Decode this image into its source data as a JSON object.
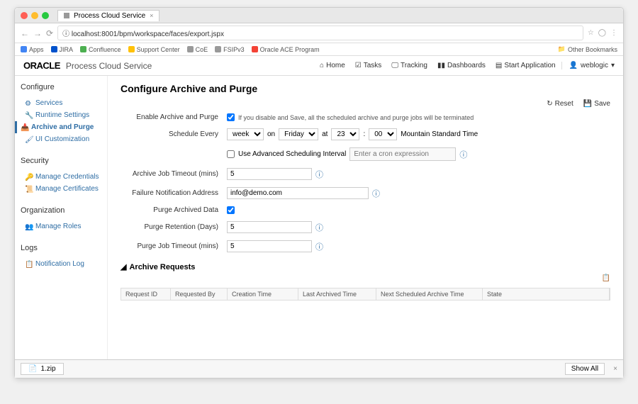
{
  "browser": {
    "tab_title": "Process Cloud Service",
    "url": "localhost:8001/bpm/workspace/faces/export.jspx",
    "bookmarks": [
      "Apps",
      "JIRA",
      "Confluence",
      "Support Center",
      "CoE",
      "FSIPv3",
      "Oracle ACE Program"
    ],
    "other_bookmarks": "Other Bookmarks"
  },
  "header": {
    "logo": "ORACLE",
    "app": "Process Cloud Service",
    "nav": {
      "home": "Home",
      "tasks": "Tasks",
      "tracking": "Tracking",
      "dashboards": "Dashboards",
      "start": "Start Application"
    },
    "user": "weblogic"
  },
  "sidebar": {
    "configure": {
      "title": "Configure",
      "items": [
        "Services",
        "Runtime Settings",
        "Archive and Purge",
        "UI Customization"
      ]
    },
    "security": {
      "title": "Security",
      "items": [
        "Manage Credentials",
        "Manage Certificates"
      ]
    },
    "organization": {
      "title": "Organization",
      "items": [
        "Manage Roles"
      ]
    },
    "logs": {
      "title": "Logs",
      "items": [
        "Notification Log"
      ]
    }
  },
  "main": {
    "title": "Configure Archive and Purge",
    "actions": {
      "reset": "Reset",
      "save": "Save"
    },
    "form": {
      "enable": {
        "label": "Enable Archive and Purge",
        "hint": "If you disable and Save, all the scheduled archive and purge jobs will be terminated"
      },
      "schedule": {
        "label": "Schedule Every",
        "unit": "week",
        "on": "on",
        "day": "Friday",
        "at": "at",
        "hour": "23",
        "colon": ":",
        "minute": "00",
        "tz": "Mountain Standard Time"
      },
      "advanced": {
        "label": "Use Advanced Scheduling Interval",
        "placeholder": "Enter a cron expression"
      },
      "timeout": {
        "label": "Archive Job Timeout (mins)",
        "value": "5"
      },
      "email": {
        "label": "Failure Notification Address",
        "value": "info@demo.com"
      },
      "purge": {
        "label": "Purge Archived Data"
      },
      "retention": {
        "label": "Purge Retention (Days)",
        "value": "5"
      },
      "purgetimeout": {
        "label": "Purge Job Timeout (mins)",
        "value": "5"
      }
    },
    "requests": {
      "title": "Archive Requests",
      "cols": [
        "Request ID",
        "Requested By",
        "Creation Time",
        "Last Archived Time",
        "Next Scheduled Archive Time",
        "State"
      ]
    }
  },
  "downloads": {
    "file": "1.zip",
    "showall": "Show All"
  }
}
